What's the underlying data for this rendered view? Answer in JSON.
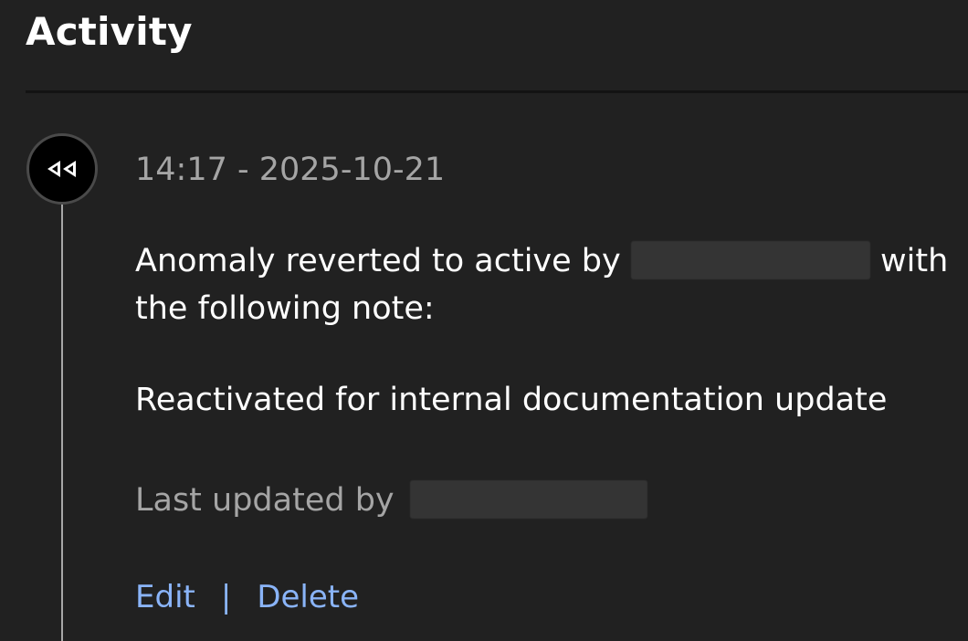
{
  "activity": {
    "title": "Activity",
    "event": {
      "icon": "rewind-icon",
      "timestamp": "14:17 - 2025-10-21",
      "message_prefix": "Anomaly reverted to active by",
      "message_suffix": "with the following note:",
      "note": "Reactivated for internal documentation update",
      "last_updated_label": "Last updated by",
      "actions": {
        "edit_label": "Edit",
        "separator": "|",
        "delete_label": "Delete"
      }
    }
  },
  "colors": {
    "background": "#212121",
    "text": "#ffffff",
    "muted_text": "#a5a5a5",
    "link": "#8ab4f8",
    "icon_bg": "#000000"
  }
}
